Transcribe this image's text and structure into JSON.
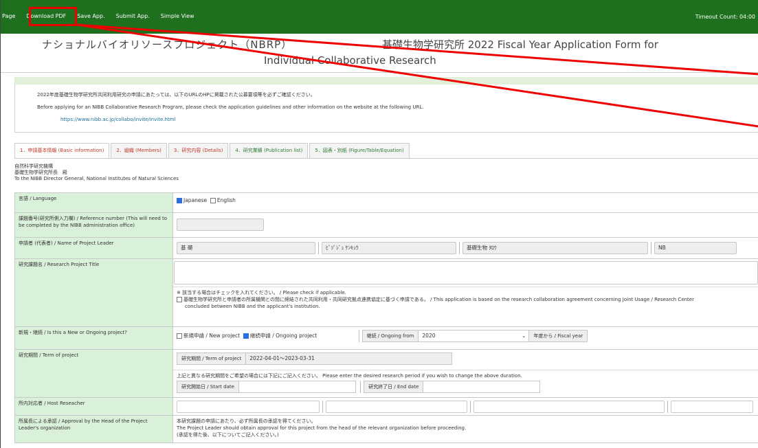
{
  "topbar": {
    "nav": [
      "Page",
      "Download PDF",
      "Save App.",
      "Submit App.",
      "Simple View"
    ],
    "timeout": "Timeout Count: 04:00"
  },
  "title": {
    "line1": "ナショナルバイオリソースプロジェクト（NBRP）",
    "line2": "基礎生物学研究所 2022 Fiscal Year Application Form for",
    "line3": "Individual Collaborative Research"
  },
  "notice": {
    "jp": "2022年度基礎生物学研究所共同利用研究の申請にあたっては、以下のURLのHPに掲載された公募要項等を必ずご確認ください。",
    "en": "Before applying for an NIBB Collaborative Research Program, please check the application guidelines and other information on the website at the following URL.",
    "url": "https://www.nibb.ac.jp/collabo/invite/invite.html"
  },
  "tabs": [
    "1．申請基本情報 (Basic information)",
    "2．組織 (Members)",
    "3．研究内容 (Details)",
    "4．研究業績 (Publication list)",
    "5．図表・別紙 (Figure/Table/Equation)"
  ],
  "addressee": {
    "line1": "自然科学研究機構",
    "line2": "基礎生物学研究所長　殿",
    "line3": "To the NIBB Director General, National Institutes of Natural Sciences"
  },
  "rows": {
    "language": {
      "label": "言語 / Language",
      "opt_jp": "Japanese",
      "opt_en": "English"
    },
    "reference": {
      "label": "課題番号(研究所側入力欄) / Reference number (This will need to be completed by the NIBB administration office)"
    },
    "leader": {
      "label": "申請者 (代表者) / Name of Project Leader",
      "f1": "基 礎",
      "f2": "ﾋﾞｿﾞｼﾞｭ ｹﾝｷｭｳ",
      "f3": "基礎生物 ﾀﾛｳ",
      "f4": "NB"
    },
    "title": {
      "label": "研究課題名 / Research Project Title",
      "note1": "※ 該当する場合はチェックを入れてください。 / Please check if applicable.",
      "note2": "基礎生物学研究所と申請者の所属機関との間に締結された共同利用・共同研究拠点連携協定に基づく申請である。 / This application is based on the research collaboration agreement concerning Joint Usage / Research Center",
      "note3": "concluded between NIBB and the applicant's institution."
    },
    "new_ongoing": {
      "label": "新規・継続 / Is this a New or Ongoing project?",
      "new_opt": "新規申請 / New project",
      "ongoing_opt": "継続申請 / Ongoing project",
      "ongoing_from_label": "継続 / Ongoing from",
      "ongoing_from_value": "2020",
      "fiscal_year": "年度から / Fiscal year"
    },
    "term": {
      "label": "研究期間 / Term of project",
      "term_label": "研究期間 / Term of project",
      "term_value": "2022-04-01～2023-03-31",
      "note": "上記と異なる研究期間をご希望の場合には下記にご記入ください。  Please enter the desired research period if you wish to change the above duration.",
      "start_label": "研究開始日 / Start date",
      "end_label": "研究終了日 / End date"
    },
    "host": {
      "label": "所内対応者 / Host Reseacher"
    },
    "approval": {
      "label": "所属長による承認 / Approval by the Head of the Project Leader's organization",
      "line1": "本研究課題の申請にあたり、必ず所属長の承認を得てください。",
      "line2": "The Project Leader should obtain approval for this project from the head of the relevant organization before proceeding.",
      "line3": "(承認を得た後、以下についてご記入ください。)"
    }
  },
  "colors": {
    "topbar": "#1e6f1e",
    "label_bg": "#d9f0d9",
    "highlight": "#e00000",
    "tab_text": "#c0392b"
  }
}
